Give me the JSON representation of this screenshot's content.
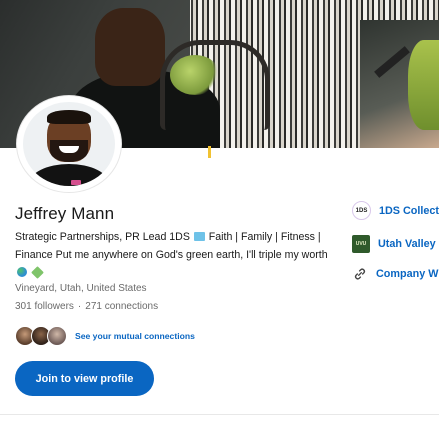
{
  "profile": {
    "name": "Jeffrey Mann",
    "headline_part1": "Strategic Partnerships, PR Lead 1DS",
    "headline_part2": "Faith | Family | Fitness | Finance Put me anywhere on God's green earth, I'll triple my worth",
    "location": "Vineyard, Utah, United States",
    "followers": "301 followers",
    "connections": "271 connections",
    "mutual_link": "See your mutual connections",
    "join_button": "Join to view profile"
  },
  "sidebar": {
    "items": [
      {
        "label": "1DS Collect",
        "logo_text": "1DS",
        "icon": "company-logo-1ds"
      },
      {
        "label": "Utah Valley",
        "logo_text": "UVU",
        "icon": "school-logo-uvu"
      },
      {
        "label": "Company W",
        "icon": "link-icon"
      }
    ]
  },
  "colors": {
    "accent": "#0a66c2",
    "muted_text": "rgba(0,0,0,0.6)",
    "primary_text": "rgba(0,0,0,0.9)"
  }
}
